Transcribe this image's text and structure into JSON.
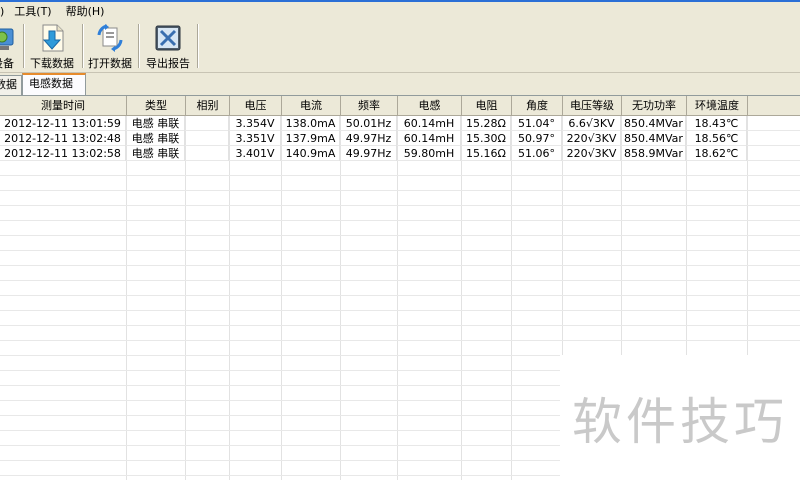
{
  "menu": {
    "stub": ")",
    "tools": "工具(T)",
    "help": "帮助(H)"
  },
  "toolbar": {
    "device_label": "设备",
    "download_label": "下载数据",
    "open_label": "打开数据",
    "export_label": "导出报告"
  },
  "tabs": [
    {
      "label": "数据"
    },
    {
      "label": "电感数据"
    }
  ],
  "table": {
    "columns": [
      "测量时间",
      "类型",
      "相别",
      "电压",
      "电流",
      "频率",
      "电感",
      "电阻",
      "角度",
      "电压等级",
      "无功功率",
      "环境温度"
    ],
    "rows": [
      [
        "2012-12-11 13:01:59",
        "电感 串联",
        "",
        "3.354V",
        "138.0mA",
        "50.01Hz",
        "60.14mH",
        "15.28Ω",
        "51.04°",
        "6.6√3KV",
        "850.4MVar",
        "18.43℃"
      ],
      [
        "2012-12-11 13:02:48",
        "电感 串联",
        "",
        "3.351V",
        "137.9mA",
        "49.97Hz",
        "60.14mH",
        "15.30Ω",
        "50.97°",
        "220√3KV",
        "850.4MVar",
        "18.56℃"
      ],
      [
        "2012-12-11 13:02:58",
        "电感 串联",
        "",
        "3.401V",
        "140.9mA",
        "49.97Hz",
        "59.80mH",
        "15.16Ω",
        "51.06°",
        "220√3KV",
        "858.9MVar",
        "18.62℃"
      ]
    ]
  },
  "watermark": "软件技巧",
  "colors": {
    "chrome": "#ece9d8",
    "tab_highlight": "#e68b2c",
    "watermark": "#c9c9c9"
  }
}
